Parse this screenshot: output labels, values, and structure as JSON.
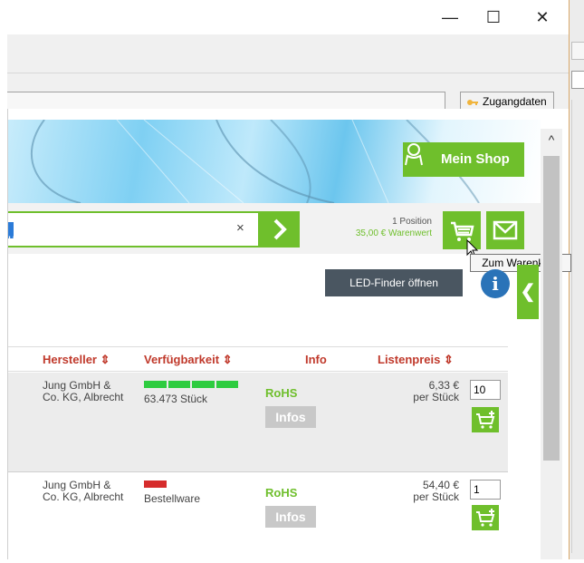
{
  "window": {
    "minimize_glyph": "—",
    "maximize_glyph": "☐",
    "close_glyph": "✕"
  },
  "toolbar": {
    "access_button": "Zugangdaten"
  },
  "header": {
    "shop_button": "Mein Shop",
    "search_value": "u",
    "clear_glyph": "×",
    "cart_summary": {
      "positions": "1 Position",
      "value": "35,00 € Warenwert"
    },
    "cart_tooltip": "Zum Warenkorb"
  },
  "tools": {
    "led_finder": "LED-Finder öffnen",
    "info_glyph": "i",
    "side_tab_glyph": "❮"
  },
  "scrollbar": {
    "up_glyph": "^"
  },
  "table": {
    "columns": [
      "Hersteller ⇕",
      "Verfügbarkeit ⇕",
      "Info",
      "Listenpreis ⇕"
    ],
    "rows": [
      {
        "manufacturer_line1": "Jung GmbH &",
        "manufacturer_line2": "Co. KG, Albrecht",
        "availability": "63.473 Stück",
        "availability_level": 1.0,
        "availability_color": "#2ecc40",
        "rohs": "RoHS",
        "infos": "Infos",
        "price": "6,33 €",
        "unit": "per Stück",
        "qty": "10"
      },
      {
        "manufacturer_line1": "Jung GmbH &",
        "manufacturer_line2": "Co. KG, Albrecht",
        "availability": "Bestellware",
        "availability_level": 0.25,
        "availability_color": "#d62c2c",
        "rohs": "RoHS",
        "infos": "Infos",
        "price": "54,40 €",
        "unit": "per Stück",
        "qty": "1"
      }
    ]
  },
  "colors": {
    "accent_green": "#6fbf2c",
    "header_red": "#c0392b",
    "led_button": "#4a5661",
    "info_blue": "#2a73b8"
  }
}
